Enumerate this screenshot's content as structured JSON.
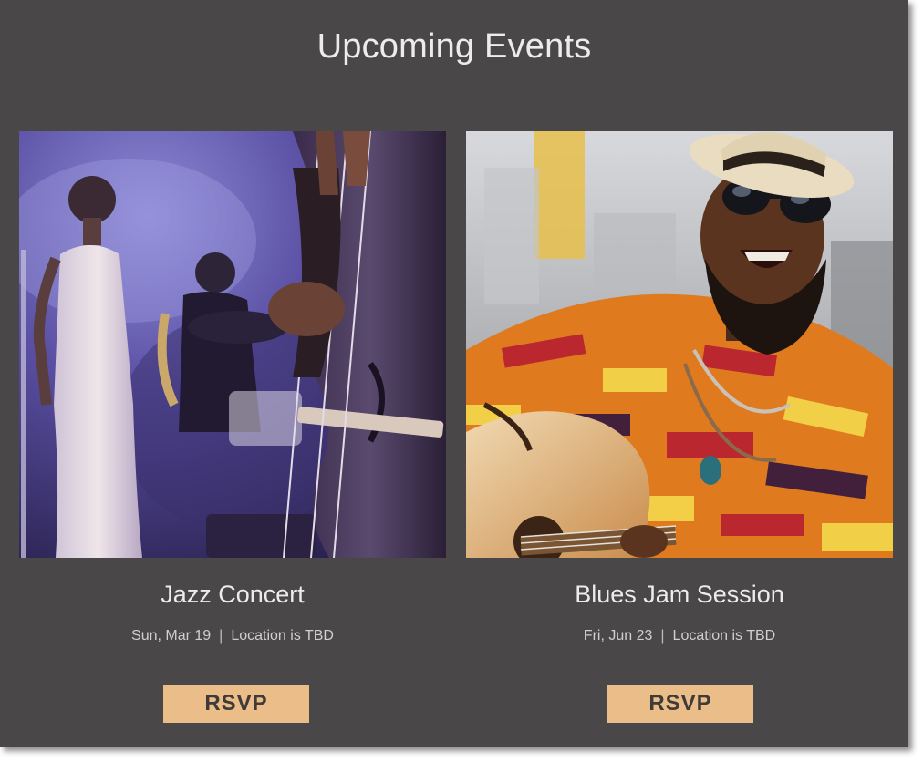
{
  "section": {
    "title": "Upcoming Events"
  },
  "events": [
    {
      "name": "Jazz Concert",
      "date": "Sun, Mar 19",
      "separator": "|",
      "location": "Location is TBD",
      "button_label": "RSVP",
      "image_icon": "jazz-band-photo"
    },
    {
      "name": "Blues Jam Session",
      "date": "Fri, Jun 23",
      "separator": "|",
      "location": "Location is TBD",
      "button_label": "RSVP",
      "image_icon": "guitarist-photo"
    }
  ],
  "colors": {
    "background": "#494747",
    "button": "#ebbd88",
    "title_text": "#ececec"
  }
}
